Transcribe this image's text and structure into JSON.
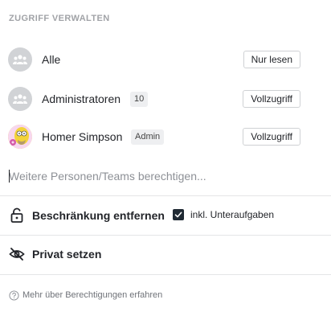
{
  "section_title": "ZUGRIFF VERWALTEN",
  "users": [
    {
      "name": "Alle",
      "badge": "",
      "permission": "Nur lesen",
      "avatar_icon": "group-icon"
    },
    {
      "name": "Administratoren",
      "badge": "10",
      "permission": "Vollzugriff",
      "avatar_icon": "group-icon"
    },
    {
      "name": "Homer Simpson",
      "badge": "Admin",
      "permission": "Vollzugriff",
      "avatar_icon": "homer-avatar"
    }
  ],
  "add_input": {
    "placeholder": "Weitere Personen/Teams berechtigen...",
    "value": ""
  },
  "restriction": {
    "label": "Beschränkung entfernen",
    "icon": "unlock-icon",
    "checkbox_label": "inkl. Unteraufgaben",
    "checkbox_checked": true
  },
  "private": {
    "label": "Privat setzen",
    "icon": "eye-off-icon"
  },
  "footer": {
    "link": "Mehr über Berechtigungen erfahren",
    "icon": "help-icon"
  },
  "colors": {
    "accent_dark": "#1f2933",
    "muted": "#a1a3a7",
    "avatar_bg": "#d1d3d6"
  }
}
